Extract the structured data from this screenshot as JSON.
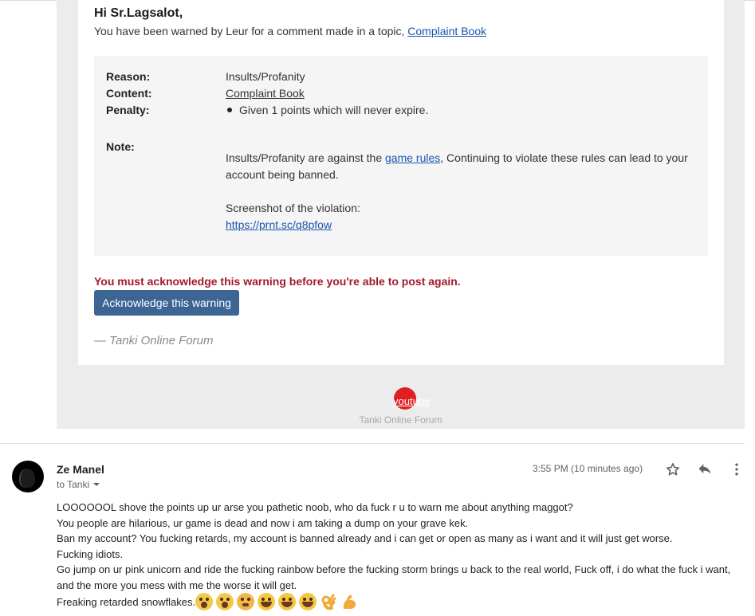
{
  "email": {
    "greeting": "Hi Sr.Lagsalot,",
    "intro_prefix": "You have been warned by Leur for a comment made in a topic,",
    "intro_link": "Complaint Book",
    "details": {
      "reason_label": "Reason:",
      "reason_value": "Insults/Profanity",
      "content_label": "Content:",
      "content_value": "Complaint Book",
      "penalty_label": "Penalty:",
      "penalty_value": "Given 1 points which will never expire.",
      "note_label": "Note:",
      "note_prefix": "Insults/Profanity are against the",
      "note_link": "game rules",
      "note_suffix": ", Continuing to violate these rules can lead to your account being banned.",
      "screenshot_label": "Screenshot of the violation:",
      "screenshot_link": "https://prnt.sc/q8pfow"
    },
    "must_ack": "You must acknowledge this warning before you're able to post again.",
    "ack_button": "Acknowledge this warning",
    "signature": "— Tanki Online Forum",
    "youtube_label": "youtube",
    "footer_name": "Tanki Online Forum"
  },
  "reply": {
    "sender": "Ze Manel",
    "to": "to Tanki",
    "time": "3:55 PM (10 minutes ago)",
    "lines": [
      "LOOOOOOL shove the points up ur arse you pathetic noob, who da fuck r u to warn me about anything maggot?",
      "You people are hilarious, ur game is dead and now i am taking a dump on your grave kek.",
      "Ban my account? You fucking retards, my account is banned already and i can get or open as many as i want and it will just get worse.",
      "Fucking idiots.",
      "Go jump on ur pink unicorn and ride the fucking rainbow before the fucking storm brings u back to the real world, Fuck off, i do what the fuck i want, and the more you mess with me the worse it will get.",
      "Freaking retarded snowflakes."
    ],
    "emojis": [
      "scream-emoji",
      "scream-emoji",
      "dizzy-face-emoji",
      "grin-emoji",
      "grin-emoji",
      "grin-emoji",
      "ok-hand-emoji",
      "flexed-biceps-emoji"
    ]
  },
  "colors": {
    "link": "#1a55b0",
    "warning_red": "#a2192c",
    "button_blue": "#3d6594",
    "youtube_red": "#e02020"
  }
}
